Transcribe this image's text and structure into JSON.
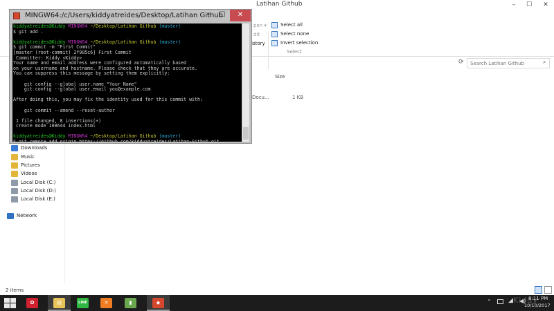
{
  "explorer": {
    "title": "Latihan Github",
    "window_controls": {
      "minimize": "–",
      "maximize": "☐",
      "close": "✕"
    },
    "ribbon": {
      "faded_open": "pen ▾",
      "faded_edit": "dit",
      "faded_history": "istory",
      "select_all": "Select all",
      "select_none": "Select none",
      "invert_selection": "Invert selection",
      "group_label": "Select"
    },
    "search_placeholder": "Search Latihan Github",
    "columns": {
      "size": "Size"
    },
    "file_row": {
      "type": "Docu...",
      "size": "1 KB"
    },
    "nav": [
      {
        "label": "Downloads",
        "icon": "downloads-folder-icon",
        "color": "#3b7bd4"
      },
      {
        "label": "Music",
        "icon": "music-folder-icon",
        "color": "#e3b53b"
      },
      {
        "label": "Pictures",
        "icon": "pictures-folder-icon",
        "color": "#e3b53b"
      },
      {
        "label": "Videos",
        "icon": "videos-folder-icon",
        "color": "#e3b53b"
      },
      {
        "label": "Local Disk (C:)",
        "icon": "drive-icon",
        "color": "#8f9aa8"
      },
      {
        "label": "Local Disk (D:)",
        "icon": "drive-icon",
        "color": "#8f9aa8"
      },
      {
        "label": "Local Disk (E:)",
        "icon": "drive-icon",
        "color": "#8f9aa8"
      },
      {
        "label": "Network",
        "icon": "network-icon",
        "color": "#2f72c4"
      }
    ],
    "status": "2 items"
  },
  "terminal": {
    "title": "MINGW64:/c/Users/kiddyatreides/Desktop/Latihan Github",
    "controls": {
      "minimize": "–",
      "maximize": "☐",
      "close": "✕"
    },
    "prompt": {
      "user": "kiddyatreides@Kiddy",
      "host": "MINGW64",
      "path": "~/Desktop/Latihan Github",
      "branch": "(master)"
    },
    "lines": [
      {
        "kind": "prompt"
      },
      {
        "kind": "text",
        "text": "$ git add ."
      },
      {
        "kind": "blank"
      },
      {
        "kind": "prompt"
      },
      {
        "kind": "text",
        "text": "$ git commit -m \"First Commit\""
      },
      {
        "kind": "text",
        "text": "[master (root-commit) 2f905c6] First Commit"
      },
      {
        "kind": "text",
        "text": " Committer: Kiddy <Kiddy>"
      },
      {
        "kind": "text",
        "text": "Your name and email address were configured automatically based"
      },
      {
        "kind": "text",
        "text": "on your username and hostname. Please check that they are accurate."
      },
      {
        "kind": "text",
        "text": "You can suppress this message by setting them explicitly:"
      },
      {
        "kind": "blank"
      },
      {
        "kind": "text",
        "text": "    git config --global user.name \"Your Name\""
      },
      {
        "kind": "text",
        "text": "    git config --global user.email you@example.com"
      },
      {
        "kind": "blank"
      },
      {
        "kind": "text",
        "text": "After doing this, you may fix the identity used for this commit with:"
      },
      {
        "kind": "blank"
      },
      {
        "kind": "text",
        "text": "    git commit --amend --reset-author"
      },
      {
        "kind": "blank"
      },
      {
        "kind": "text",
        "text": " 1 file changed, 8 insertions(+)"
      },
      {
        "kind": "text",
        "text": " create mode 100644 index.html"
      },
      {
        "kind": "blank"
      },
      {
        "kind": "prompt"
      },
      {
        "kind": "text",
        "text": "$ git remote add origin https://github.com/kiddyatreides/Latihan-Github.git"
      }
    ]
  },
  "taskbar": {
    "apps": [
      {
        "name": "opera",
        "glyph": "O",
        "color": "#d1202f",
        "active": false
      },
      {
        "name": "file-explorer",
        "glyph": "▤",
        "color": "#e7c35a",
        "active": true
      },
      {
        "name": "line",
        "glyph": "LINE",
        "color": "#2fb742",
        "active": false
      },
      {
        "name": "xampp",
        "glyph": "✕",
        "color": "#f07d22",
        "active": false
      },
      {
        "name": "task-manager",
        "glyph": "▮",
        "color": "#6aa84f",
        "active": false
      },
      {
        "name": "git-bash",
        "glyph": "◆",
        "color": "#d5482e",
        "active": true
      }
    ],
    "time": "6:11 PM",
    "date": "10/10/2017",
    "watermark": "Kiddy"
  }
}
